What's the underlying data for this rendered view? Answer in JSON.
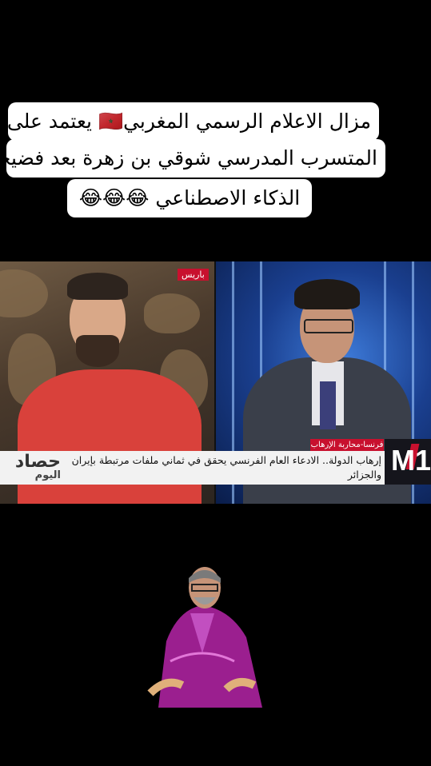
{
  "caption": {
    "line1": "مزال الاعلام الرسمي المغربي🇲🇦 يعتمد على",
    "line2": "المتسرب المدرسي شوقي بن زهرة بعد فضيحة",
    "line3": "الذكاء الاصطناعي 😂😂😂"
  },
  "video": {
    "location_tag": "باريس",
    "ticker_category": "فرنسا-محاربة الإرهاب",
    "ticker_headline": "إرهاب الدولة.. الادعاء العام الفرنسي يحقق في ثماني ملفات مرتبطة بإيران والجزائر",
    "brand_line1": "حصاد",
    "brand_line2": "اليوم",
    "channel_logo": "M1",
    "colors": {
      "accent_red": "#c8102e",
      "ticker_bg": "#f2f2f2",
      "studio_blue": "#1a3f8f"
    }
  },
  "figure": {
    "icon": "man-in-magenta-djellaba-cutout"
  }
}
